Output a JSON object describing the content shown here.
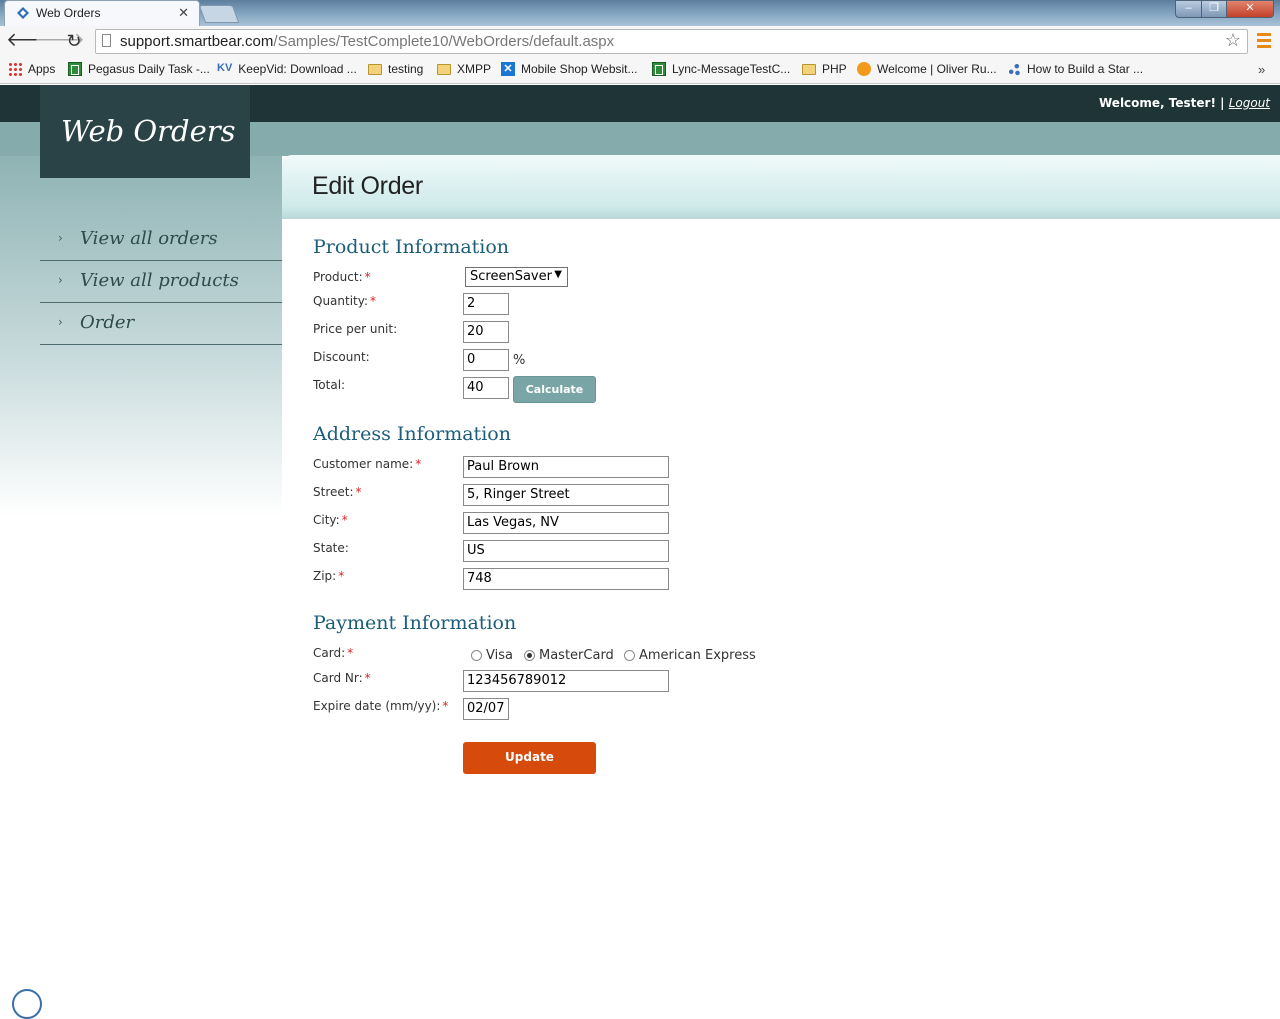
{
  "browser": {
    "tab_title": "Web Orders",
    "close_glyph": "✕",
    "url_domain": "support.smartbear.com",
    "url_path": "/Samples/TestComplete10/WebOrders/default.aspx",
    "back_glyph": "🡐",
    "forward_glyph": "🡒",
    "reload_glyph": "↻",
    "star_glyph": "☆",
    "min_glyph": "–",
    "max_glyph": "❐",
    "win_close_glyph": "✕",
    "more_glyph": "»",
    "bookmarks": [
      {
        "label": "Apps",
        "icon": "apps-grid-icon"
      },
      {
        "label": "Pegasus Daily Task -...",
        "icon": "spreadsheet-icon"
      },
      {
        "label": "KeepVid: Download ...",
        "icon": "kv-icon",
        "icon_text": "KV"
      },
      {
        "label": "testing",
        "icon": "folder-icon"
      },
      {
        "label": "XMPP",
        "icon": "folder-icon"
      },
      {
        "label": "Mobile Shop Websit...",
        "icon": "x-icon",
        "icon_text": "✕"
      },
      {
        "label": "Lync-MessageTestC...",
        "icon": "spreadsheet-icon"
      },
      {
        "label": "PHP",
        "icon": "folder-icon"
      },
      {
        "label": "Welcome | Oliver Ru...",
        "icon": "orange-circle-icon"
      },
      {
        "label": "How to Build a Star ...",
        "icon": "nodes-icon"
      }
    ]
  },
  "site": {
    "logo": "Web Orders",
    "welcome": "Welcome, Tester!",
    "separator": "|",
    "logout": "Logout",
    "nav_chevron": "›",
    "nav": [
      "View all orders",
      "View all products",
      "Order"
    ]
  },
  "page": {
    "title": "Edit Order",
    "required_mark": "*",
    "product_section": {
      "heading": "Product Information",
      "product_label": "Product:",
      "product_value": "ScreenSaver",
      "select_arrow": "▼",
      "quantity_label": "Quantity:",
      "quantity_value": "2",
      "price_label": "Price per unit:",
      "price_value": "20",
      "discount_label": "Discount:",
      "discount_value": "0",
      "percent": "%",
      "total_label": "Total:",
      "total_value": "40",
      "calculate_button": "Calculate"
    },
    "address_section": {
      "heading": "Address Information",
      "name_label": "Customer name:",
      "name_value": "Paul Brown",
      "street_label": "Street:",
      "street_value": "5, Ringer Street",
      "city_label": "City:",
      "city_value": "Las Vegas, NV",
      "state_label": "State:",
      "state_value": "US",
      "zip_label": "Zip:",
      "zip_value": "748"
    },
    "payment_section": {
      "heading": "Payment Information",
      "card_label": "Card:",
      "card_options": [
        "Visa",
        "MasterCard",
        "American Express"
      ],
      "card_selected": "MasterCard",
      "card_nr_label": "Card Nr:",
      "card_nr_value": "123456789012",
      "expire_label": "Expire date (mm/yy):",
      "expire_value": "02/07"
    },
    "update_button": "Update"
  }
}
